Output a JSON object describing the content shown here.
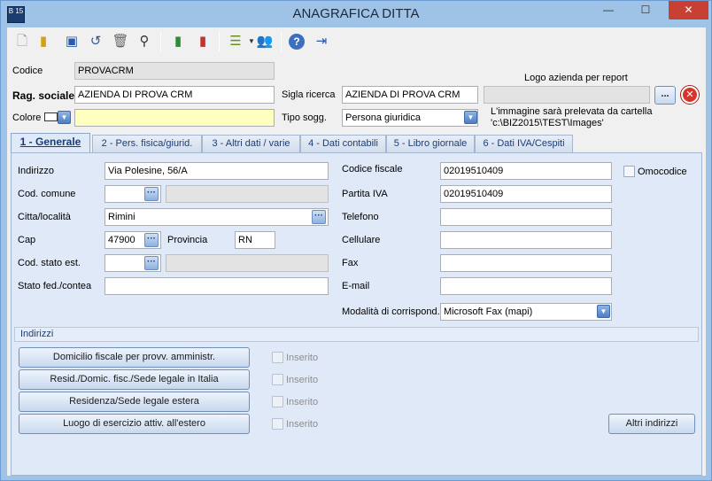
{
  "window": {
    "title": "ANAGRAFICA DITTA",
    "app_icon_text": "B 15",
    "close_label": "✕",
    "min_label": "—",
    "max_label": "☐"
  },
  "toolbar": {
    "icons": [
      "new-document-icon",
      "open-folder-icon",
      "save-icon",
      "undo-icon",
      "delete-trash-icon",
      "binoculars-search-icon",
      "copy-green-book-icon",
      "red-book-icon",
      "list-options-icon",
      "users-icon",
      "help-icon",
      "exit-door-icon"
    ]
  },
  "header": {
    "codice_label": "Codice",
    "codice_value": "PROVACRM",
    "rag_sociale_label": "Rag. sociale",
    "rag_sociale_value": "AZIENDA DI PROVA CRM",
    "sigla_label": "Sigla ricerca",
    "sigla_value": "AZIENDA DI PROVA CRM",
    "colore_label": "Colore",
    "colore_value": "",
    "tipo_sogg_label": "Tipo sogg.",
    "tipo_sogg_value": "Persona giuridica",
    "logo_label": "Logo azienda per report",
    "logo_value": "",
    "logo_browse": "...",
    "logo_note_1": "L'immagine sarà prelevata da cartella",
    "logo_note_2": "'c:\\BIZ2015\\TEST\\Images'"
  },
  "tabs": [
    {
      "label": "1 - Generale"
    },
    {
      "label": "2 - Pers. fisica/giurid."
    },
    {
      "label": "3 - Altri dati / varie"
    },
    {
      "label": "4 - Dati contabili"
    },
    {
      "label": "5 - Libro giornale"
    },
    {
      "label": "6 - Dati IVA/Cespiti"
    }
  ],
  "generale": {
    "indirizzo_label": "Indirizzo",
    "indirizzo_value": "Via Polesine, 56/A",
    "cod_comune_label": "Cod. comune",
    "cod_comune_value": "",
    "citta_label": "Citta/località",
    "citta_value": "Rimini",
    "cap_label": "Cap",
    "cap_value": "47900",
    "provincia_label": "Provincia",
    "provincia_value": "RN",
    "cod_stato_label": "Cod. stato est.",
    "cod_stato_value": "",
    "stato_fed_label": "Stato fed./contea",
    "stato_fed_value": "",
    "codice_fiscale_label": "Codice fiscale",
    "codice_fiscale_value": "02019510409",
    "omocodice_label": "Omocodice",
    "partita_iva_label": "Partita IVA",
    "partita_iva_value": "02019510409",
    "telefono_label": "Telefono",
    "telefono_value": "",
    "cellulare_label": "Cellulare",
    "cellulare_value": "",
    "fax_label": "Fax",
    "fax_value": "",
    "email_label": "E-mail",
    "email_value": "",
    "modalita_label": "Modalità di corrispond.",
    "modalita_value": "Microsoft Fax (mapi)"
  },
  "indirizzi": {
    "group_label": "Indirizzi",
    "buttons": [
      {
        "label": "Domicilio fiscale per provv. amministr.",
        "inserito": "Inserito"
      },
      {
        "label": "Resid./Domic. fisc./Sede legale in Italia",
        "inserito": "Inserito"
      },
      {
        "label": "Residenza/Sede legale estera",
        "inserito": "Inserito"
      },
      {
        "label": "Luogo di esercizio attiv. all'estero",
        "inserito": "Inserito"
      }
    ],
    "altri_label": "Altri indirizzi"
  }
}
